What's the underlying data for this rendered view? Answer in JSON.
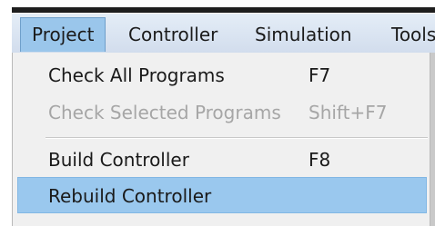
{
  "menubar": {
    "items": [
      {
        "label": "Project",
        "active": true
      },
      {
        "label": "Controller",
        "active": false
      },
      {
        "label": "Simulation",
        "active": false
      },
      {
        "label": "Tools",
        "active": false
      }
    ]
  },
  "dropdown": {
    "items": [
      {
        "label": "Check All Programs",
        "shortcut": "F7",
        "enabled": true,
        "highlighted": false
      },
      {
        "label": "Check Selected Programs",
        "shortcut": "Shift+F7",
        "enabled": false,
        "highlighted": false
      },
      {
        "label": "Build Controller",
        "shortcut": "F8",
        "enabled": true,
        "highlighted": false
      },
      {
        "label": "Rebuild Controller",
        "shortcut": "",
        "enabled": true,
        "highlighted": true
      }
    ]
  },
  "colors": {
    "menubar_bg": "#dbe5f2",
    "active_menu_bg": "#9ac6eb",
    "highlight_bg": "#9ac8ee",
    "dropdown_bg": "#f0f0f0",
    "disabled_text": "#a6a6a6"
  }
}
